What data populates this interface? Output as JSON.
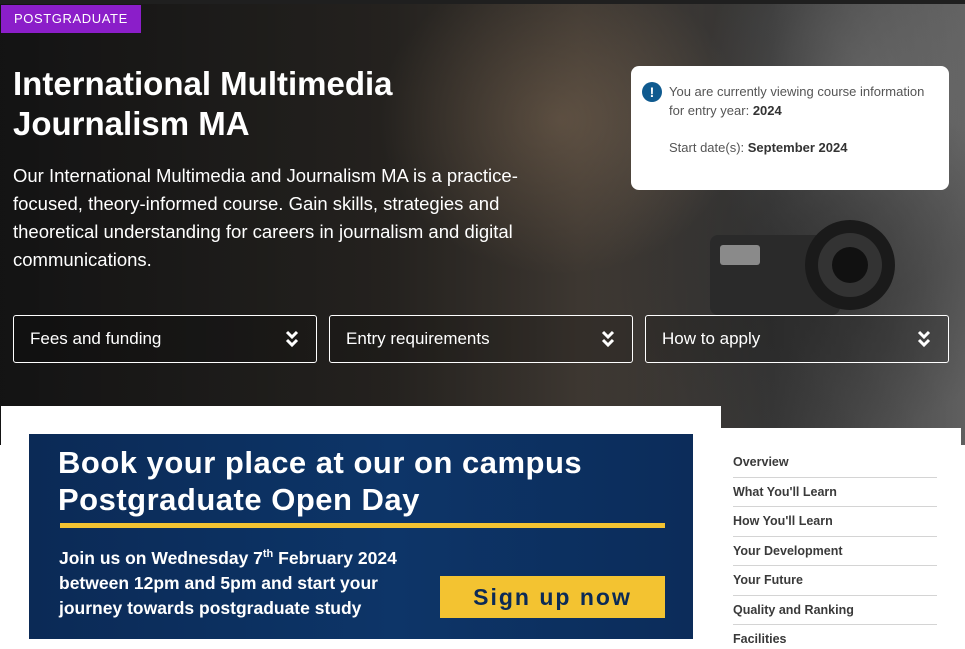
{
  "badge": "POSTGRADUATE",
  "course": {
    "title": "International Multimedia Journalism MA",
    "intro": "Our International Multimedia and Journalism MA is a practice-focused, theory-informed course. Gain skills, strategies and theoretical understanding for careers in journalism and digital communications."
  },
  "info_box": {
    "icon": "exclamation-icon",
    "viewing_text": "You are currently viewing course information for entry year: ",
    "entry_year": "2024",
    "start_label": "Start date(s): ",
    "start_value": "September 2024"
  },
  "dropdowns": [
    {
      "label": "Fees and funding",
      "icon": "double-chevron-down-icon"
    },
    {
      "label": "Entry requirements",
      "icon": "double-chevron-down-icon"
    },
    {
      "label": "How to apply",
      "icon": "double-chevron-down-icon"
    }
  ],
  "banner": {
    "title_line1": "Book your place at our on campus",
    "title_line2": "Postgraduate Open Day",
    "body_line1_prefix": "Join us on Wednesday 7",
    "body_line1_sup": "th",
    "body_line1_suffix": " February 2024",
    "body_line2": "between 12pm and 5pm and start your",
    "body_line3": "journey towards postgraduate study",
    "cta": "Sign up now",
    "colors": {
      "background": "#0b2a56",
      "accent": "#f3c331"
    }
  },
  "side_nav": [
    "Overview",
    "What You'll Learn",
    "How You'll Learn",
    "Your Development",
    "Your Future",
    "Quality and Ranking",
    "Facilities"
  ],
  "colors": {
    "badge": "#8b1ec9",
    "info_icon": "#0f5a8f"
  }
}
